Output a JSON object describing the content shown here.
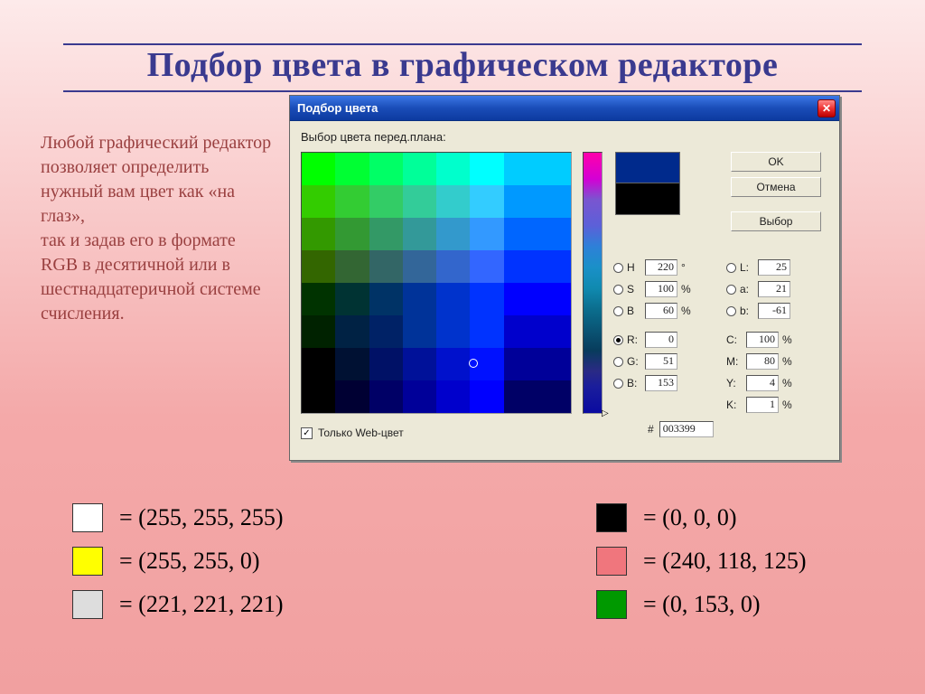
{
  "page_title": "Подбор цвета в графическом редакторе",
  "side_text": "Любой графический редактор позволяет определить нужный вам цвет как «на глаз»,\nтак и задав его в формате\nRGB в десятичной или в шестнадцатеричной системе счисления.",
  "dialog": {
    "title": "Подбор цвета",
    "label": "Выбор цвета перед.плана:",
    "buttons": {
      "ok": "OK",
      "cancel": "Отмена",
      "select": "Выбор"
    },
    "hsb": {
      "H": "220",
      "H_suf": "°",
      "S": "100",
      "S_suf": "%",
      "B": "60",
      "B_suf": "%"
    },
    "lab": {
      "L": "25",
      "a": "21",
      "b": "-61"
    },
    "rgb": {
      "R": "0",
      "G": "51",
      "B": "153"
    },
    "cmyk": {
      "C": "100",
      "M": "80",
      "Y": "4",
      "K": "1",
      "suf": "%"
    },
    "hex_label": "#",
    "hex": "003399",
    "web_only": "Только Web-цвет"
  },
  "examples": {
    "left": [
      {
        "color": "#ffffff",
        "text": "= (255, 255, 255)"
      },
      {
        "color": "#ffff00",
        "text": "= (255, 255, 0)"
      },
      {
        "color": "#dddddd",
        "text": "= (221, 221, 221)"
      }
    ],
    "right": [
      {
        "color": "#000000",
        "text": "= (0, 0, 0)"
      },
      {
        "color": "#f0767d",
        "text": "= (240, 118, 125)"
      },
      {
        "color": "#009900",
        "text": "= (0, 153, 0)"
      }
    ]
  },
  "palette_colors": [
    "#00ff00",
    "#00ff33",
    "#00ff66",
    "#00ff99",
    "#00ffcc",
    "#00ffff",
    "#00ccff",
    "#00ccff",
    "#33cc00",
    "#33cc33",
    "#33cc66",
    "#33cc99",
    "#33cccc",
    "#33ccff",
    "#0099ff",
    "#0099ff",
    "#339900",
    "#339933",
    "#339966",
    "#339999",
    "#3399cc",
    "#3399ff",
    "#0066ff",
    "#0066ff",
    "#336600",
    "#336633",
    "#336666",
    "#336699",
    "#3366cc",
    "#3366ff",
    "#0033ff",
    "#0033ff",
    "#003300",
    "#003333",
    "#003366",
    "#003399",
    "#0033cc",
    "#0033ff",
    "#0000ff",
    "#0000ff",
    "#002200",
    "#002244",
    "#002266",
    "#003399",
    "#0033cc",
    "#0033ff",
    "#0000cc",
    "#0000cc",
    "#000000",
    "#001133",
    "#001166",
    "#001199",
    "#0011cc",
    "#0011ff",
    "#000099",
    "#000099",
    "#000000",
    "#000033",
    "#000066",
    "#000099",
    "#0000cc",
    "#0000ff",
    "#000066",
    "#000066"
  ]
}
